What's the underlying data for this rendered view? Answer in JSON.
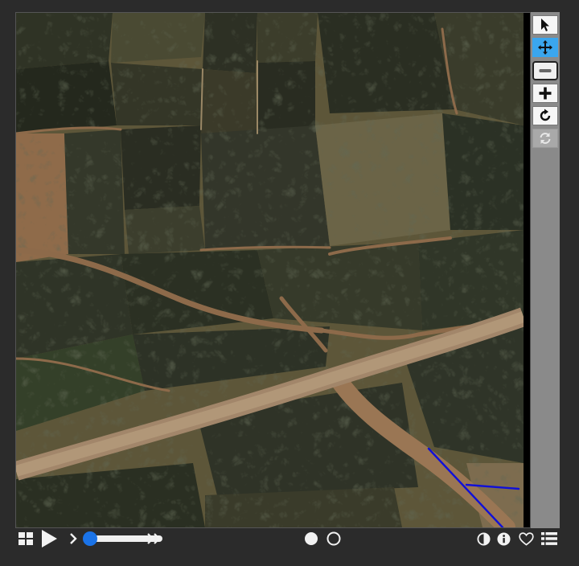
{
  "title": "",
  "viewer": {
    "image_kind": "satellite-farmland"
  },
  "toolbar": {
    "tools": [
      {
        "name": "select-tool-button",
        "icon": "cursor-arrow-icon",
        "state": "normal"
      },
      {
        "name": "pan-tool-button",
        "icon": "move-arrows-icon",
        "state": "active"
      },
      {
        "name": "zoom-out-button",
        "icon": "minus-icon",
        "state": "outlined"
      },
      {
        "name": "zoom-in-button",
        "icon": "plus-icon",
        "state": "normal"
      },
      {
        "name": "rotate-button",
        "icon": "rotate-clockwise-icon",
        "state": "normal"
      },
      {
        "name": "refresh-button",
        "icon": "refresh-icon",
        "state": "disabled"
      }
    ]
  },
  "bottom_bar": {
    "left_icons": [
      "grid-icon",
      "play-icon",
      "chevron-right-icon"
    ],
    "slider": {
      "value": 0.0
    },
    "after_slider_icon": "double-chevron-right-icon",
    "center_icons": [
      "filled-circle-icon",
      "empty-circle-icon"
    ],
    "right_icons": [
      "contrast-icon",
      "info-icon",
      "heart-icon",
      "list-icon"
    ]
  },
  "colors": {
    "background": "#2b2b2b",
    "toolbar": "#8a8a8a",
    "active_tool": "#3aa6ee",
    "slider_thumb": "#1a73e8",
    "annotation_line": "#1010d8"
  }
}
